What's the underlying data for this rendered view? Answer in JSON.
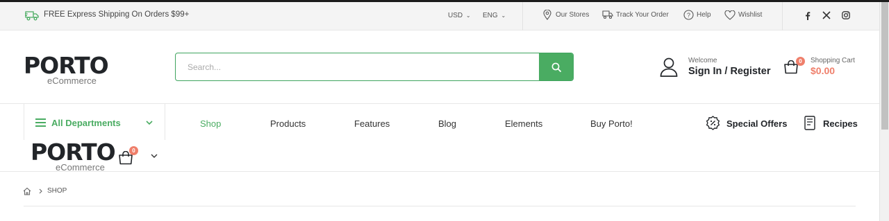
{
  "topbar": {
    "shipping_text": "FREE Express Shipping On Orders $99+",
    "currency": "USD",
    "language": "ENG",
    "links": {
      "stores": "Our Stores",
      "track": "Track Your Order",
      "help": "Help",
      "wishlist": "Wishlist"
    },
    "social": [
      "facebook-icon",
      "x-icon",
      "instagram-icon"
    ]
  },
  "header": {
    "logo_main": "PORTO",
    "logo_sub": "eCommerce",
    "search": {
      "placeholder": "Search..."
    },
    "account": {
      "welcome": "Welcome",
      "sign_in": "Sign In",
      "separator": " / ",
      "register": "Register"
    },
    "cart": {
      "label": "Shopping Cart",
      "total": "$0.00",
      "count": "0"
    }
  },
  "nav": {
    "departments_label": "All Departments",
    "items": [
      "Shop",
      "Products",
      "Features",
      "Blog",
      "Elements",
      "Buy Porto!"
    ],
    "special_offers": "Special Offers",
    "recipes": "Recipes"
  },
  "sticky": {
    "logo_main": "PORTO",
    "logo_sub": "eCommerce",
    "cart_count": "0"
  },
  "breadcrumb": {
    "current": "SHOP"
  },
  "colors": {
    "accent_green": "#4aac62",
    "badge": "#ef7f6b",
    "price": "#ef7f6b",
    "dark": "#222529"
  }
}
